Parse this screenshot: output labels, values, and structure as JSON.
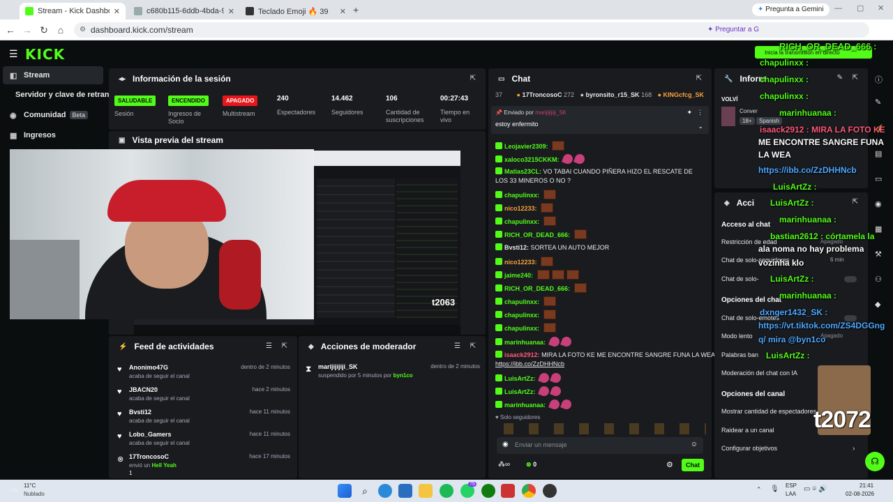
{
  "browser": {
    "tabs": [
      {
        "label": "Stream - Kick Dashboard",
        "active": true
      },
      {
        "label": "c680b115-6ddb-4bda-90ef-8b0",
        "active": false
      },
      {
        "label": "Teclado Emoji 🔥 39",
        "active": false
      }
    ],
    "gemini_label": "Pregunta a Gemini",
    "url": "dashboard.kick.com/stream",
    "preguntar_label": "Preguntar a G"
  },
  "app": {
    "logo": "KICK"
  },
  "sidebar": {
    "items": [
      {
        "label": "Stream"
      },
      {
        "label": "Servidor y clave de retransm"
      },
      {
        "label": "Comunidad",
        "badge": "Beta"
      },
      {
        "label": "Ingresos"
      }
    ]
  },
  "session": {
    "title": "Información de la sesión",
    "stats": [
      {
        "chip": "SALUDABLE",
        "label": "Sesión"
      },
      {
        "chip": "ENCENDIDO",
        "label": "Ingresos de Socio"
      },
      {
        "chip": "APAGADO",
        "label": "Multistream"
      },
      {
        "value": "240",
        "label": "Espectadores"
      },
      {
        "value": "14.462",
        "label": "Seguidores"
      },
      {
        "value": "106",
        "label": "Cantidad de suscripciones"
      },
      {
        "value": "00:27:43",
        "label": "Tiempo en vivo"
      }
    ]
  },
  "preview": {
    "title": "Vista previa del stream",
    "overlay_tag": "t2063"
  },
  "feed": {
    "title": "Feed de actividades",
    "items": [
      {
        "name": "Anonimo47G",
        "sub": "acaba de seguir el canal",
        "time": "dentro de 2 minutos"
      },
      {
        "name": "JBACN20",
        "sub": "acaba de seguir el canal",
        "time": "hace 2 minutos"
      },
      {
        "name": "Bvsti12",
        "sub": "acaba de seguir el canal",
        "time": "hace 11 minutos"
      },
      {
        "name": "Lobo_Gamers",
        "sub": "acaba de seguir el canal",
        "time": "hace 11 minutos"
      },
      {
        "name": "17TroncosoC",
        "sub": "envió un",
        "gift": "Hell Yeah",
        "time": "hace 17 minutos",
        "count": "1"
      }
    ]
  },
  "modactions": {
    "title": "Acciones de moderador",
    "items": [
      {
        "name": "marijijijiji_SK",
        "sub": "suspendido por 5 minutos por",
        "by": "byn1co",
        "time": "dentro de 2 minutos"
      }
    ]
  },
  "chat": {
    "title": "Chat",
    "top_count": "37",
    "leaders": [
      {
        "name": "17TroncosoC",
        "count": "272"
      },
      {
        "name": "byronsito_r15_SK",
        "count": "168"
      },
      {
        "name": "KINGcfcg_SK",
        "count": ""
      }
    ],
    "pinned_by": "Enviado por",
    "pinned_user": "marijijijiji_SK",
    "pinned_msg": "estoy enfermito",
    "messages": [
      {
        "user": "Leojavier2309:",
        "color": "#53fc18",
        "text": ""
      },
      {
        "user": "xaloco3215CKKM:",
        "color": "#53fc18",
        "text": ""
      },
      {
        "user": "Matias23CL:",
        "color": "#53fc18",
        "text": "VO TABAI CUANDO PIÑERA HIZO EL RESCATE DE"
      },
      {
        "user": "",
        "color": "#e8eaeb",
        "text": "LOS 33 MINEROS O NO ?"
      },
      {
        "user": "chapulinxx:",
        "color": "#53fc18",
        "text": ""
      },
      {
        "user": "nico12233:",
        "color": "#f7a23b",
        "text": ""
      },
      {
        "user": "chapulinxx:",
        "color": "#53fc18",
        "text": ""
      },
      {
        "user": "RICH_OR_DEAD_666:",
        "color": "#53fc18",
        "text": ""
      },
      {
        "user": "Bvsti12:",
        "color": "#e8eaeb",
        "text": "SORTEA UN AUTO MEJOR"
      },
      {
        "user": "nico12233:",
        "color": "#f7a23b",
        "text": ""
      },
      {
        "user": "jaime240:",
        "color": "#53fc18",
        "text": ""
      },
      {
        "user": "RICH_OR_DEAD_666:",
        "color": "#53fc18",
        "text": ""
      },
      {
        "user": "chapulinxx:",
        "color": "#53fc18",
        "text": ""
      },
      {
        "user": "chapulinxx:",
        "color": "#53fc18",
        "text": ""
      },
      {
        "user": "chapulinxx:",
        "color": "#53fc18",
        "text": ""
      },
      {
        "user": "marinhuanaa:",
        "color": "#53fc18",
        "text": ""
      },
      {
        "user": "isaack2912:",
        "color": "#ff5a7a",
        "text": "MIRA LA FOTO KE ME ENCONTRE SANGRE FUNA LA WEA"
      },
      {
        "user": "",
        "color": "#e8eaeb",
        "text": "https://ibb.co/ZzDHHNcb"
      },
      {
        "user": "LuisArtZz:",
        "color": "#53fc18",
        "text": ""
      },
      {
        "user": "LuisArtZz:",
        "color": "#53fc18",
        "text": ""
      },
      {
        "user": "marinhuanaa:",
        "color": "#53fc18",
        "text": ""
      }
    ],
    "followers_only": "Solo seguidores",
    "input_placeholder": "Enviar un mensaje",
    "points": "0",
    "send_label": "Chat"
  },
  "right": {
    "info_title": "Inform",
    "volvi": "VOLVÍ",
    "conversa": "Conver",
    "age": "18+",
    "lang": "Spanish",
    "actions_title": "Acci",
    "access_title": "Acceso al chat",
    "rows": [
      "Restricción de edad",
      "Chat de solo-seguidores",
      "Chat de solo-",
      "Opciones del chat",
      "Chat de solo-emotes",
      "Modo lento",
      "Palabras ban",
      "Moderación del chat con IA",
      "Opciones del canal",
      "Mostrar cantidad de espectadores",
      "Raidear a un canal",
      "Configurar objetivos"
    ],
    "apagado": "Apagado",
    "six_min": "6 min",
    "apagado2": "Apagado"
  },
  "overlay": {
    "top_name": "RICH_OR_DEAD_666 :",
    "go_live": "Inicia la transmisión en directo",
    "lines": [
      "chapulinxx :",
      "chapulinxx :",
      "chapulinxx :",
      "marinhuanaa :",
      "isaack2912 : MIRA LA FOTO KE",
      "ME ENCONTRE SANGRE FUNA",
      "LA WEA",
      "https://ibb.co/ZzDHHNcb",
      "LuisArtZz :",
      "LuisArtZz :",
      "marinhuanaa :",
      "bastian2612 : córtamela la",
      "ala noma no hay problema",
      "vozinha klo",
      "LuisArtZz :",
      "marinhuanaa :",
      "dxnger1432_SK :",
      "https://vt.tiktok.com/ZS4DGGng",
      "q/ mira @byn1co",
      "LuisArtZz :"
    ],
    "tag": "t2072"
  },
  "taskbar": {
    "temp": "11°C",
    "weather": "Nublado",
    "lang": "ESP",
    "layout": "LAA",
    "time": "21:41",
    "date": "02-08-2026",
    "whatsapp_badge": "75"
  },
  "colors": {
    "kick_green": "#53fc18",
    "bg": "#0b0e0f",
    "panel": "#191b1f",
    "red": "#e8161b"
  }
}
